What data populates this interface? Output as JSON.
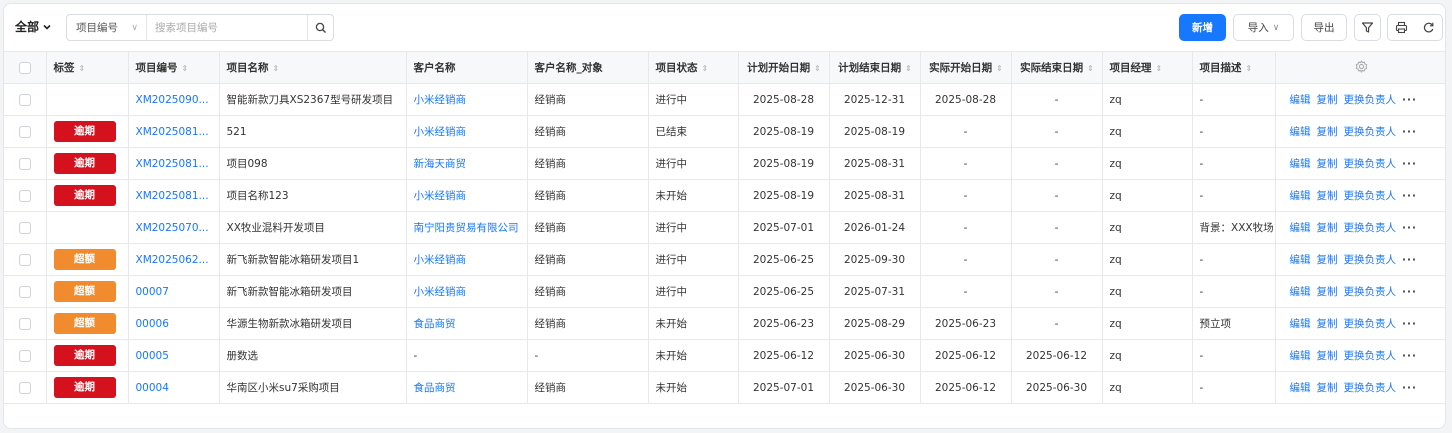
{
  "toolbar": {
    "scope_label": "全部",
    "search_field": "项目编号",
    "search_placeholder": "搜索项目编号",
    "new_label": "新增",
    "import_label": "导入",
    "export_label": "导出"
  },
  "colors": {
    "primary": "#1677ff",
    "tag_overdue": "#d4111d",
    "tag_over_budget": "#f08c2e"
  },
  "columns": [
    {
      "key": "tag",
      "label": "标签",
      "sortable": true
    },
    {
      "key": "code",
      "label": "项目编号",
      "sortable": true
    },
    {
      "key": "name",
      "label": "项目名称",
      "sortable": true
    },
    {
      "key": "customer",
      "label": "客户名称",
      "sortable": false
    },
    {
      "key": "customer_obj",
      "label": "客户名称_对象",
      "sortable": false
    },
    {
      "key": "status",
      "label": "项目状态",
      "sortable": true
    },
    {
      "key": "plan_start",
      "label": "计划开始日期",
      "sortable": true
    },
    {
      "key": "plan_end",
      "label": "计划结束日期",
      "sortable": true
    },
    {
      "key": "act_start",
      "label": "实际开始日期",
      "sortable": true
    },
    {
      "key": "act_end",
      "label": "实际结束日期",
      "sortable": true
    },
    {
      "key": "manager",
      "label": "项目经理",
      "sortable": true
    },
    {
      "key": "desc",
      "label": "项目描述",
      "sortable": true
    }
  ],
  "actions": {
    "edit": "编辑",
    "copy": "复制",
    "change_owner": "更换负责人",
    "more": "···"
  },
  "rows": [
    {
      "tag": "",
      "tag_type": "",
      "code": "XM2025090...",
      "name": "智能新款刀具XS2367型号研发项目",
      "customer": "小米经销商",
      "customer_obj": "经销商",
      "status": "进行中",
      "plan_start": "2025-08-28",
      "plan_end": "2025-12-31",
      "act_start": "2025-08-28",
      "act_end": "-",
      "manager": "zq",
      "desc": "-"
    },
    {
      "tag": "逾期",
      "tag_type": "overdue",
      "code": "XM2025081...",
      "name": "521",
      "customer": "小米经销商",
      "customer_obj": "经销商",
      "status": "已结束",
      "plan_start": "2025-08-19",
      "plan_end": "2025-08-19",
      "act_start": "-",
      "act_end": "-",
      "manager": "zq",
      "desc": "-"
    },
    {
      "tag": "逾期",
      "tag_type": "overdue",
      "code": "XM2025081...",
      "name": "项目098",
      "customer": "新海天商贸",
      "customer_obj": "经销商",
      "status": "进行中",
      "plan_start": "2025-08-19",
      "plan_end": "2025-08-31",
      "act_start": "-",
      "act_end": "-",
      "manager": "zq",
      "desc": "-"
    },
    {
      "tag": "逾期",
      "tag_type": "overdue",
      "code": "XM2025081...",
      "name": "项目名称123",
      "customer": "小米经销商",
      "customer_obj": "经销商",
      "status": "未开始",
      "plan_start": "2025-08-19",
      "plan_end": "2025-08-31",
      "act_start": "-",
      "act_end": "-",
      "manager": "zq",
      "desc": "-"
    },
    {
      "tag": "",
      "tag_type": "",
      "code": "XM2025070...",
      "name": "XX牧业混料开发项目",
      "customer": "南宁阳贵贸易有限公司",
      "customer_obj": "经销商",
      "status": "进行中",
      "plan_start": "2025-07-01",
      "plan_end": "2026-01-24",
      "act_start": "-",
      "act_end": "-",
      "manager": "zq",
      "desc": "背景：XXX牧场"
    },
    {
      "tag": "超额",
      "tag_type": "over",
      "code": "XM2025062...",
      "name": "新飞新款智能冰箱研发项目1",
      "customer": "小米经销商",
      "customer_obj": "经销商",
      "status": "进行中",
      "plan_start": "2025-06-25",
      "plan_end": "2025-09-30",
      "act_start": "-",
      "act_end": "-",
      "manager": "zq",
      "desc": "-"
    },
    {
      "tag": "超额",
      "tag_type": "over",
      "code": "00007",
      "name": "新飞新款智能冰箱研发项目",
      "customer": "小米经销商",
      "customer_obj": "经销商",
      "status": "进行中",
      "plan_start": "2025-06-25",
      "plan_end": "2025-07-31",
      "act_start": "-",
      "act_end": "-",
      "manager": "zq",
      "desc": "-"
    },
    {
      "tag": "超额",
      "tag_type": "over",
      "code": "00006",
      "name": "华源生物新款冰箱研发项目",
      "customer": "食品商贸",
      "customer_obj": "经销商",
      "status": "未开始",
      "plan_start": "2025-06-23",
      "plan_end": "2025-08-29",
      "act_start": "2025-06-23",
      "act_end": "-",
      "manager": "zq",
      "desc": "预立项"
    },
    {
      "tag": "逾期",
      "tag_type": "overdue",
      "code": "00005",
      "name": "册数选",
      "customer": "-",
      "customer_obj": "-",
      "status": "未开始",
      "plan_start": "2025-06-12",
      "plan_end": "2025-06-30",
      "act_start": "2025-06-12",
      "act_end": "2025-06-12",
      "manager": "zq",
      "desc": "-"
    },
    {
      "tag": "逾期",
      "tag_type": "overdue",
      "code": "00004",
      "name": "华南区小米su7采购项目",
      "customer": "食品商贸",
      "customer_obj": "经销商",
      "status": "未开始",
      "plan_start": "2025-07-01",
      "plan_end": "2025-06-30",
      "act_start": "2025-06-12",
      "act_end": "2025-06-30",
      "manager": "zq",
      "desc": "-"
    }
  ]
}
